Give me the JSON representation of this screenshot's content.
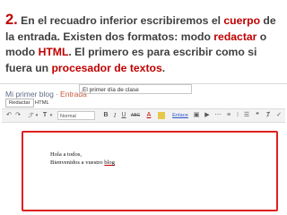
{
  "caption": {
    "number": "2.",
    "part1": " En el  recuadro inferior escribiremos el ",
    "cuerpo": "cuerpo",
    "part2": " de la entrada. Existen dos formatos: modo ",
    "redactar": "redactar",
    "part3": " o modo ",
    "html": "HTML",
    "part4": ". El primero es para escribir como si fuera un ",
    "procesador": "procesador de textos",
    "part5": "."
  },
  "editor": {
    "blog_name": "Mi primer blog",
    "crumb": "· Entrada",
    "post_title": "El primer día de clase",
    "tabs": [
      "Redactar",
      "HTML"
    ],
    "toolbar": {
      "format": "Normal",
      "bold": "B",
      "italic": "I",
      "underline": "U",
      "strike": "ABC",
      "font_color": "A",
      "link": "Enlace"
    },
    "body_line1": "Hola a todos,",
    "body_line2_a": "Bienvenidos a vuestro ",
    "body_line2_b": "blog"
  },
  "colors": {
    "accent_red": "#c00000",
    "highlight_border": "#e02020"
  }
}
